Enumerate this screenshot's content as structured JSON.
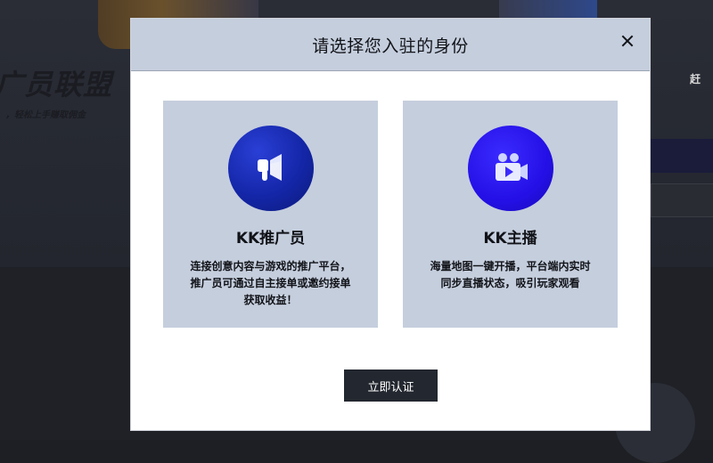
{
  "background": {
    "hero_title": "广员联盟",
    "hero_subtitle": "，轻松上手赚取佣金",
    "right_text": "赶"
  },
  "modal": {
    "title": "请选择您入驻的身份",
    "close_icon": "close-icon",
    "cards": [
      {
        "icon": "megaphone-icon",
        "title": "KK推广员",
        "description": "连接创意内容与游戏的推广平台，推广员可通过自主接单或邀约接单获取收益！"
      },
      {
        "icon": "video-camera-icon",
        "title": "KK主播",
        "description": "海量地图一键开播，平台端内实时同步直播状态，吸引玩家观看"
      }
    ],
    "verify_button": "立即认证"
  },
  "colors": {
    "header_bg": "#c5cedd",
    "card_bg": "#c5cedd",
    "button_bg": "#23272f",
    "promoter_icon": "#1426a8",
    "streamer_icon": "#2410e6"
  }
}
